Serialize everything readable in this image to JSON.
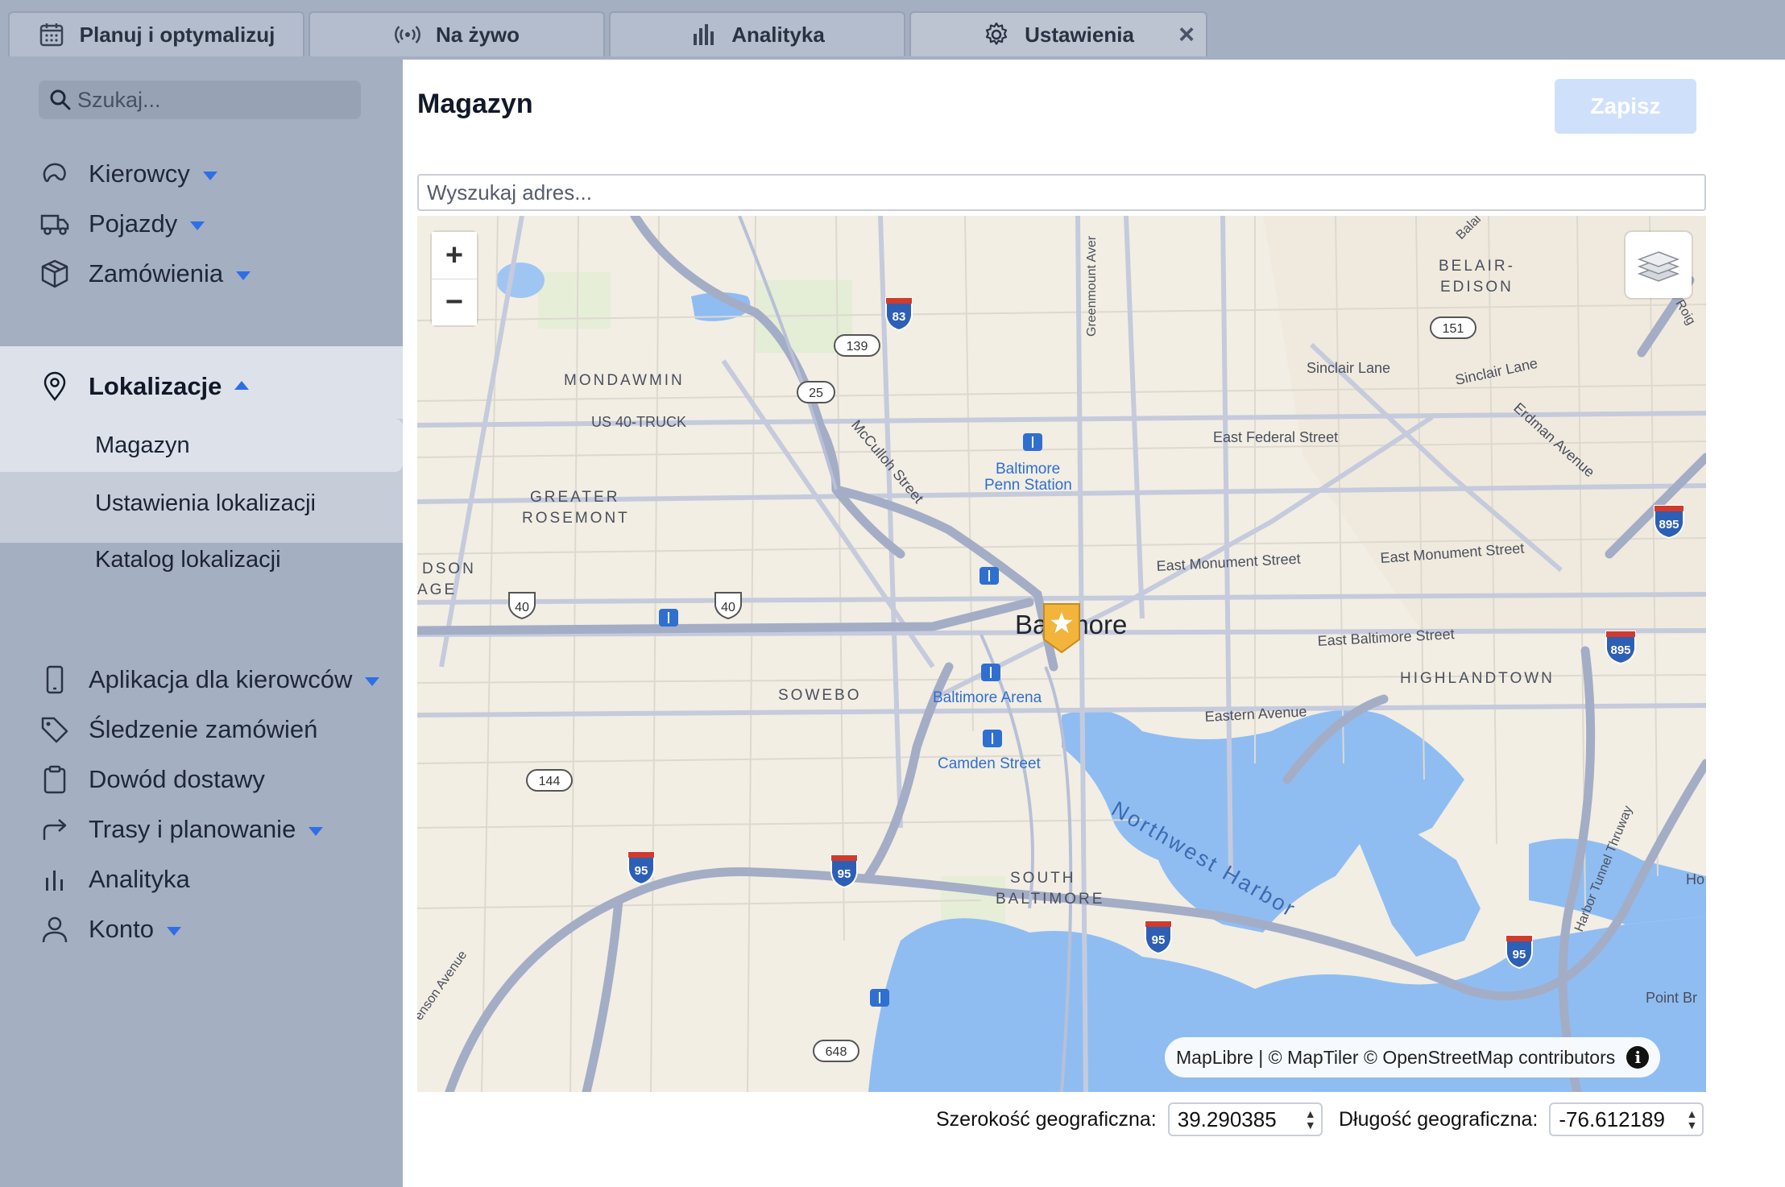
{
  "tabs": [
    {
      "label": "Planuj i optymalizuj",
      "icon": "calendar-icon"
    },
    {
      "label": "Na żywo",
      "icon": "broadcast-icon"
    },
    {
      "label": "Analityka",
      "icon": "bar-chart-icon"
    },
    {
      "label": "Ustawienia",
      "icon": "gear-icon",
      "active": true
    }
  ],
  "sidebar": {
    "search_placeholder": "Szukaj...",
    "items": [
      {
        "label": "Kierowcy",
        "icon": "steering-icon"
      },
      {
        "label": "Pojazdy",
        "icon": "truck-icon"
      },
      {
        "label": "Zamówienia",
        "icon": "package-icon"
      },
      {
        "label": "Lokalizacje",
        "icon": "location-pin-icon",
        "expanded": true
      },
      {
        "label": "Aplikacja dla kierowców",
        "icon": "mobile-icon"
      },
      {
        "label": "Śledzenie zamówień",
        "icon": "tag-icon"
      },
      {
        "label": "Dowód dostawy",
        "icon": "clipboard-icon"
      },
      {
        "label": "Trasy i planowanie",
        "icon": "route-arrow-icon"
      },
      {
        "label": "Analityka",
        "icon": "bar-chart-icon"
      },
      {
        "label": "Konto",
        "icon": "user-icon"
      }
    ],
    "sub_items": [
      {
        "label": "Magazyn",
        "selected": true
      },
      {
        "label": "Ustawienia lokalizacji"
      },
      {
        "label": "Katalog lokalizacji"
      }
    ]
  },
  "main": {
    "title": "Magazyn",
    "save_label": "Zapisz",
    "address_placeholder": "Wyszukaj adres...",
    "map": {
      "attribution": "MapLibre | © MapTiler © OpenStreetMap contributors",
      "info_label": "i",
      "zoom_in": "+",
      "zoom_out": "−",
      "labels": {
        "mondawmin": "MONDAWMIN",
        "us40truck": "US 40-TRUCK",
        "greater1": "GREATER",
        "greater2": "ROSEMONT",
        "dson": "DSON",
        "age": "AGE",
        "sowebo": "SOWEBO",
        "south1": "SOUTH",
        "south2": "BALTIMORE",
        "highlandtown": "HIGHLANDTOWN",
        "belair1": "BELAIR-",
        "belair2": "EDISON",
        "baltimore": "Baltimore",
        "penn1": "Baltimore",
        "penn2": "Penn Station",
        "arena": "Baltimore Arena",
        "camden": "Camden Street",
        "east_federal": "East Federal Street",
        "east_monument_1": "East Monument Street",
        "east_monument_2": "East Monument Street",
        "east_baltimore": "East Baltimore Street",
        "eastern_ave": "Eastern Avenue",
        "sinclair1": "Sinclair Lane",
        "sinclair2": "Sinclair Lane",
        "erdman": "Erdman Avenue",
        "mcculloh": "McCulloh Street",
        "greenmount": "Greenmount Aver",
        "harbor": "Northwest Harbor",
        "tunnel": "Harbor Tunnel Thruway",
        "jenson": "enson Avenue",
        "balai": "Balai",
        "point": "Point Br",
        "ho": "Ho",
        "roig": "Roig"
      },
      "shields": {
        "i83": "83",
        "i895a": "895",
        "i895b": "895",
        "i95a": "95",
        "i95b": "95",
        "i95c": "95",
        "i95d": "95",
        "us40a": "40",
        "us40b": "40",
        "r139": "139",
        "r25": "25",
        "r151": "151",
        "r144": "144",
        "r648": "648"
      }
    },
    "latitude_label": "Szerokość geograficzna:",
    "latitude_value": "39.290385",
    "longitude_label": "Długość geograficzna:",
    "longitude_value": "-76.612189"
  }
}
